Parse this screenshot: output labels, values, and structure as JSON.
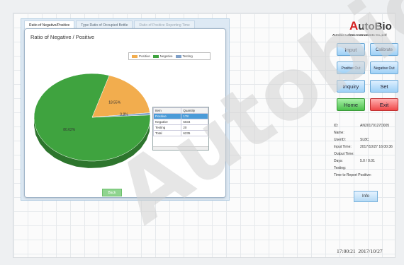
{
  "tabs": [
    {
      "label": "Ratio of Negative/Positive",
      "active": true
    },
    {
      "label": "Type Ratio of Occupied Bottle",
      "active": false
    },
    {
      "label": "Ratio of Positive Reporting Time",
      "active": false
    }
  ],
  "chart_title": "Ratio of Negative / Positive",
  "chart_data": {
    "type": "pie",
    "title": "Ratio of Negative / Positive",
    "categories": [
      "Negative",
      "Positive",
      "Testing"
    ],
    "values": [
      80.62,
      18.55,
      0.83
    ],
    "data_labels": [
      "80.62%",
      "18.55%",
      "0.8%"
    ],
    "colors": [
      "#3fa33f",
      "#f2ad4e",
      "#7fa0c8"
    ],
    "legend": [
      "Positive",
      "Negative",
      "Testing"
    ],
    "legend_placement": "top-right"
  },
  "legend_colors": {
    "Positive": "#f2ad4e",
    "Negative": "#3fa33f",
    "Testing": "#7fa0c8"
  },
  "table": {
    "headers": [
      "Item",
      "Quantity"
    ],
    "rows": [
      [
        "Positive",
        "178"
      ],
      [
        "Negative",
        "5034"
      ],
      [
        "Testing",
        "20"
      ],
      [
        "Total",
        "6235"
      ]
    ]
  },
  "back_label": "Back",
  "brand": {
    "logo_first": "A",
    "logo_rest": "utoBio",
    "company": "Autobio Labtec Instruments Co.,Ltd"
  },
  "buttons": {
    "input": "Input",
    "calibrate": "Calibrate",
    "positive_out": "Positive Out",
    "negative_out": "Negative Out",
    "inquiry": "Inquiry",
    "set": "Set",
    "home": "Home",
    "exit": "Exit",
    "info": "Info"
  },
  "info": {
    "id_label": "ID:",
    "id_value": "AN20170127D005",
    "name_label": "Name:",
    "name_value": "",
    "userid_label": "UserID:",
    "userid_value": "SL8C",
    "input_time_label": "Input Time:",
    "input_time_value": "2017/10/27  16:00:36",
    "output_time_label": "Output Time:",
    "output_time_value": "",
    "days_label": "Days:",
    "days_value": "5.0  /  0.01",
    "testing_label": "Testing:",
    "testing_value": "",
    "report_label": "Time to Report Positive:"
  },
  "clock": {
    "time": "17:00:21",
    "date": "2017/10/27"
  },
  "watermark": "Autobio"
}
